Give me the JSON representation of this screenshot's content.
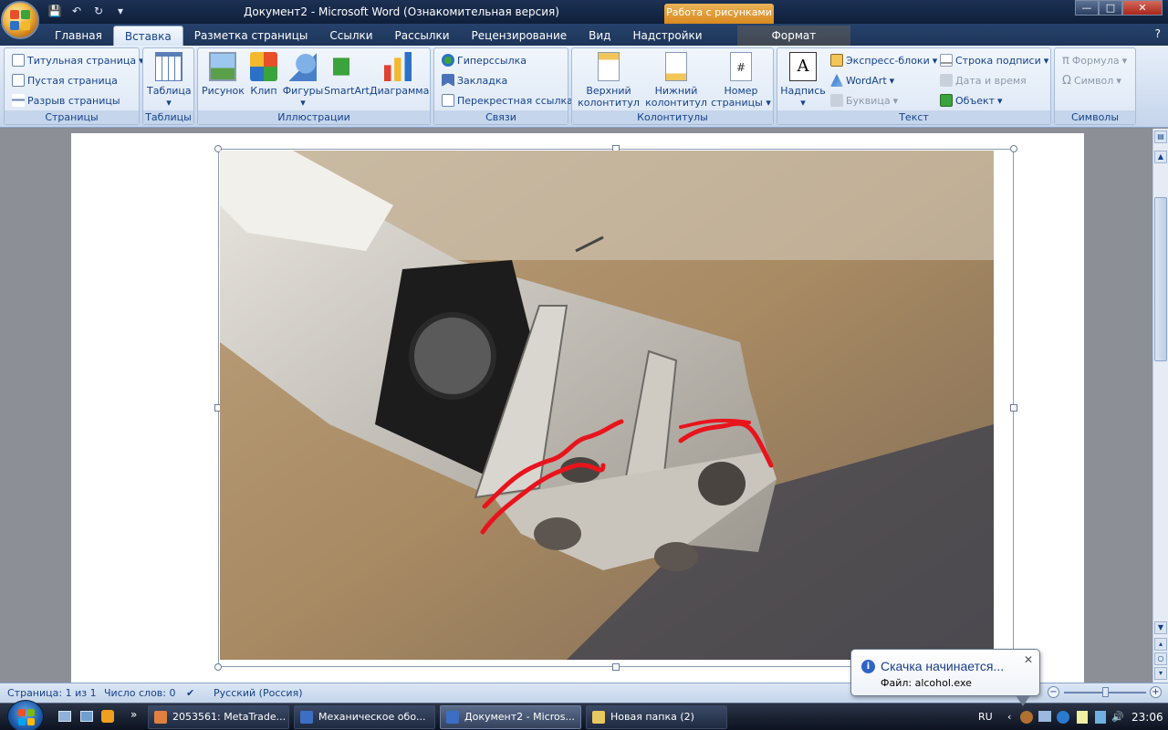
{
  "window": {
    "title": "Документ2 - Microsoft Word (Ознакомительная версия)",
    "context_tab": "Работа с рисунками",
    "controls": [
      "—",
      "□",
      "✕"
    ]
  },
  "tabs": [
    {
      "label": "Главная"
    },
    {
      "label": "Вставка"
    },
    {
      "label": "Разметка страницы"
    },
    {
      "label": "Ссылки"
    },
    {
      "label": "Рассылки"
    },
    {
      "label": "Рецензирование"
    },
    {
      "label": "Вид"
    },
    {
      "label": "Надстройки"
    },
    {
      "label": "Формат"
    }
  ],
  "active_tab": "Вставка",
  "ribbon": {
    "pages": {
      "label": "Страницы",
      "items": [
        "Титульная страница",
        "Пустая страница",
        "Разрыв страницы"
      ]
    },
    "tables": {
      "label": "Таблицы",
      "button": "Таблица"
    },
    "illustrations": {
      "label": "Иллюстрации",
      "buttons": [
        "Рисунок",
        "Клип",
        "Фигуры",
        "SmartArt",
        "Диаграмма"
      ]
    },
    "links": {
      "label": "Связи",
      "items": [
        "Гиперссылка",
        "Закладка",
        "Перекрестная ссылка"
      ]
    },
    "headers": {
      "label": "Колонтитулы",
      "buttons": [
        {
          "line1": "Верхний",
          "line2": "колонтитул"
        },
        {
          "line1": "Нижний",
          "line2": "колонтитул"
        },
        {
          "line1": "Номер",
          "line2": "страницы"
        }
      ]
    },
    "text": {
      "label": "Текст",
      "big": "Надпись",
      "col1": [
        "Экспресс-блоки",
        "WordArt",
        "Буквица"
      ],
      "col2": [
        "Строка подписи",
        "Дата и время",
        "Объект"
      ]
    },
    "symbols": {
      "label": "Символы",
      "items": [
        "Формула",
        "Символ"
      ]
    }
  },
  "status": {
    "page": "Страница: 1 из 1",
    "words": "Число слов: 0",
    "language": "Русский (Россия)"
  },
  "balloon": {
    "title": "Скачка начинается...",
    "file": "Файл: alcohol.exe"
  },
  "taskbar": {
    "items": [
      {
        "label": "2053561: MetaTrade..."
      },
      {
        "label": "Механическое обо..."
      },
      {
        "label": "Документ2 - Micros..."
      },
      {
        "label": "Новая папка (2)"
      }
    ],
    "lang": "RU",
    "clock": "23:06",
    "more": "»"
  },
  "colors": {
    "annotation": "#e8141c",
    "ribbon_text": "#15428b"
  }
}
